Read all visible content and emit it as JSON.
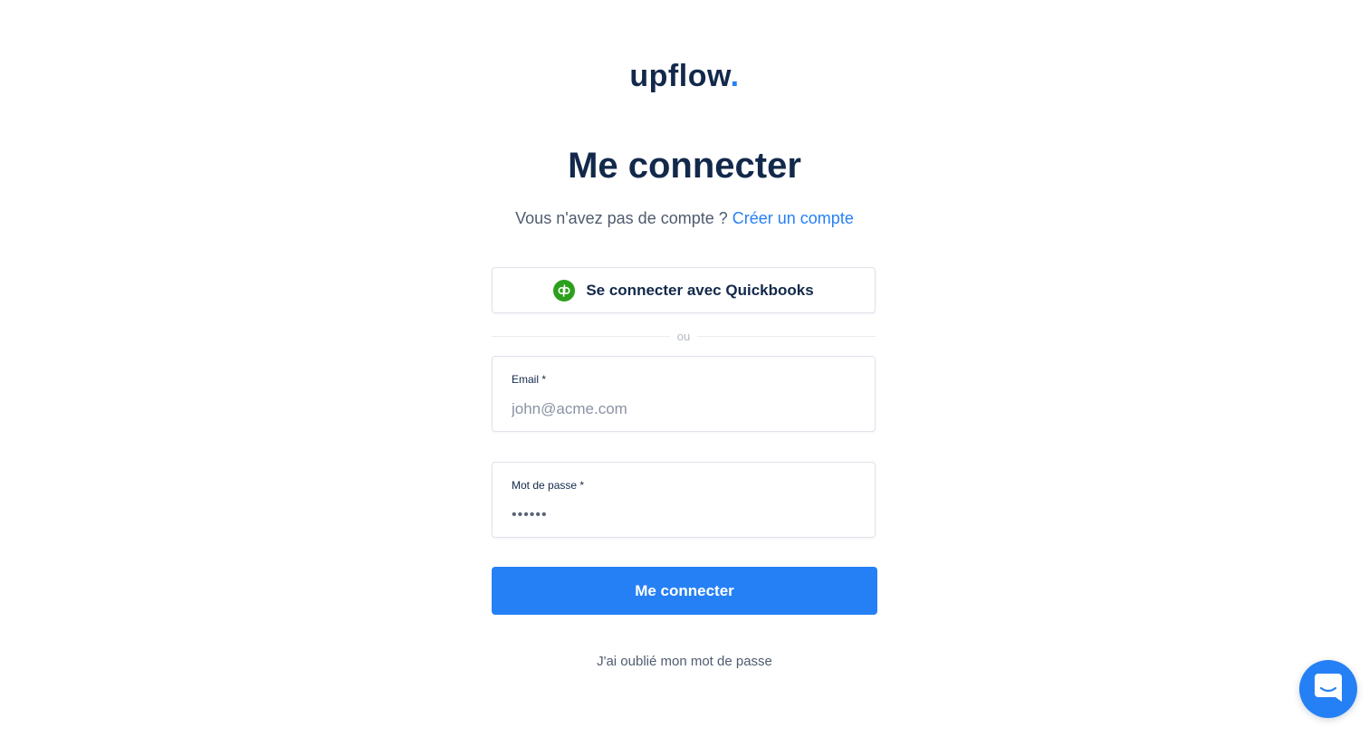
{
  "brand": {
    "logo_text": "upflow",
    "logo_dot": ".",
    "accent_color": "#2680f5",
    "text_color": "#13294b"
  },
  "header": {
    "title": "Me connecter",
    "subtitle_text": "Vous n'avez pas de compte ?",
    "create_account_link": "Créer un compte"
  },
  "oauth": {
    "quickbooks_label": "Se connecter avec Quickbooks",
    "quickbooks_icon": "quickbooks-icon",
    "quickbooks_color": "#2ca01c"
  },
  "divider": {
    "text": "ou"
  },
  "form": {
    "email": {
      "label": "Email *",
      "placeholder": "john@acme.com",
      "value": ""
    },
    "password": {
      "label": "Mot de passe *",
      "masked_value": "••••••"
    },
    "submit_label": "Me connecter",
    "forgot_password_link": "J'ai oublié mon mot de passe"
  },
  "chat": {
    "icon": "chat-bubble-icon"
  }
}
